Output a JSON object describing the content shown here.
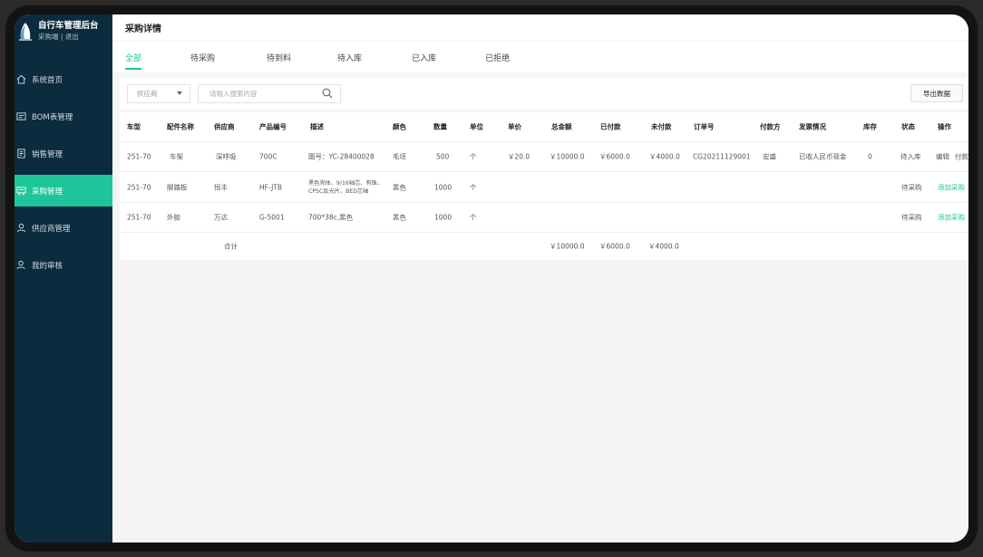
{
  "brand": {
    "title": "自行车管理后台",
    "subtitle": "采购端 | 退出"
  },
  "sidebar": {
    "items": [
      {
        "label": "系统首页",
        "icon": "home-icon"
      },
      {
        "label": "BOM表管理",
        "icon": "bom-icon"
      },
      {
        "label": "销售管理",
        "icon": "sales-icon"
      },
      {
        "label": "采购管理",
        "icon": "cart-icon",
        "active": true
      },
      {
        "label": "供应商管理",
        "icon": "supplier-icon"
      },
      {
        "label": "我的审核",
        "icon": "audit-icon"
      }
    ]
  },
  "header": {
    "title": "采购详情"
  },
  "tabs": [
    "全部",
    "待采购",
    "待到料",
    "待入库",
    "已入库",
    "已拒绝"
  ],
  "filters": {
    "supplier_placeholder": "供应商",
    "search_placeholder": "请输入搜索内容",
    "export_label": "导出数据"
  },
  "table": {
    "columns": [
      "车型",
      "配件名称",
      "供应商",
      "产品编号",
      "描述",
      "颜色",
      "数量",
      "单位",
      "单价",
      "总金额",
      "已付款",
      "未付款",
      "订单号",
      "付款方",
      "发票情况",
      "库存",
      "状态",
      "操作"
    ],
    "rows": [
      {
        "model": "251-70",
        "part": "车架",
        "supplier": "深呼吸",
        "code": "700C",
        "desc": "图号：YC-28400028",
        "color": "毛坯",
        "qty": "500",
        "unit": "个",
        "price": "￥20.0",
        "total": "￥10000.0",
        "paid": "￥6000.0",
        "unpaid": "￥4000.0",
        "order": "CG20211129001",
        "payer": "宏盛",
        "invoice": "已收人民币现金",
        "stock": "0",
        "status": "待入库",
        "action1": "编辑",
        "action2": "付款"
      },
      {
        "model": "251-70",
        "part": "脚踏板",
        "supplier": "恒丰",
        "code": "HF-JTB",
        "desc": "黑色壳体、9/16轴芯、有珠、CPSC反光片、BED芯轴",
        "color": "黑色",
        "qty": "1000",
        "unit": "个",
        "price": "",
        "total": "",
        "paid": "",
        "unpaid": "",
        "order": "",
        "payer": "",
        "invoice": "",
        "stock": "",
        "status": "待采购",
        "action1": "添加采购",
        "action2": ""
      },
      {
        "model": "251-70",
        "part": "外胎",
        "supplier": "万达",
        "code": "G-5001",
        "desc": "700*38c,黑色",
        "color": "黑色",
        "qty": "1000",
        "unit": "个",
        "price": "",
        "total": "",
        "paid": "",
        "unpaid": "",
        "order": "",
        "payer": "",
        "invoice": "",
        "stock": "",
        "status": "待采购",
        "action1": "添加采购",
        "action2": ""
      }
    ],
    "summary": {
      "label": "合计",
      "total": "￥10000.0",
      "paid": "￥6000.0",
      "unpaid": "￥4000.0"
    }
  },
  "colors": {
    "accent": "#1ec59a",
    "sidebar_bg": "#0b2b3e"
  }
}
